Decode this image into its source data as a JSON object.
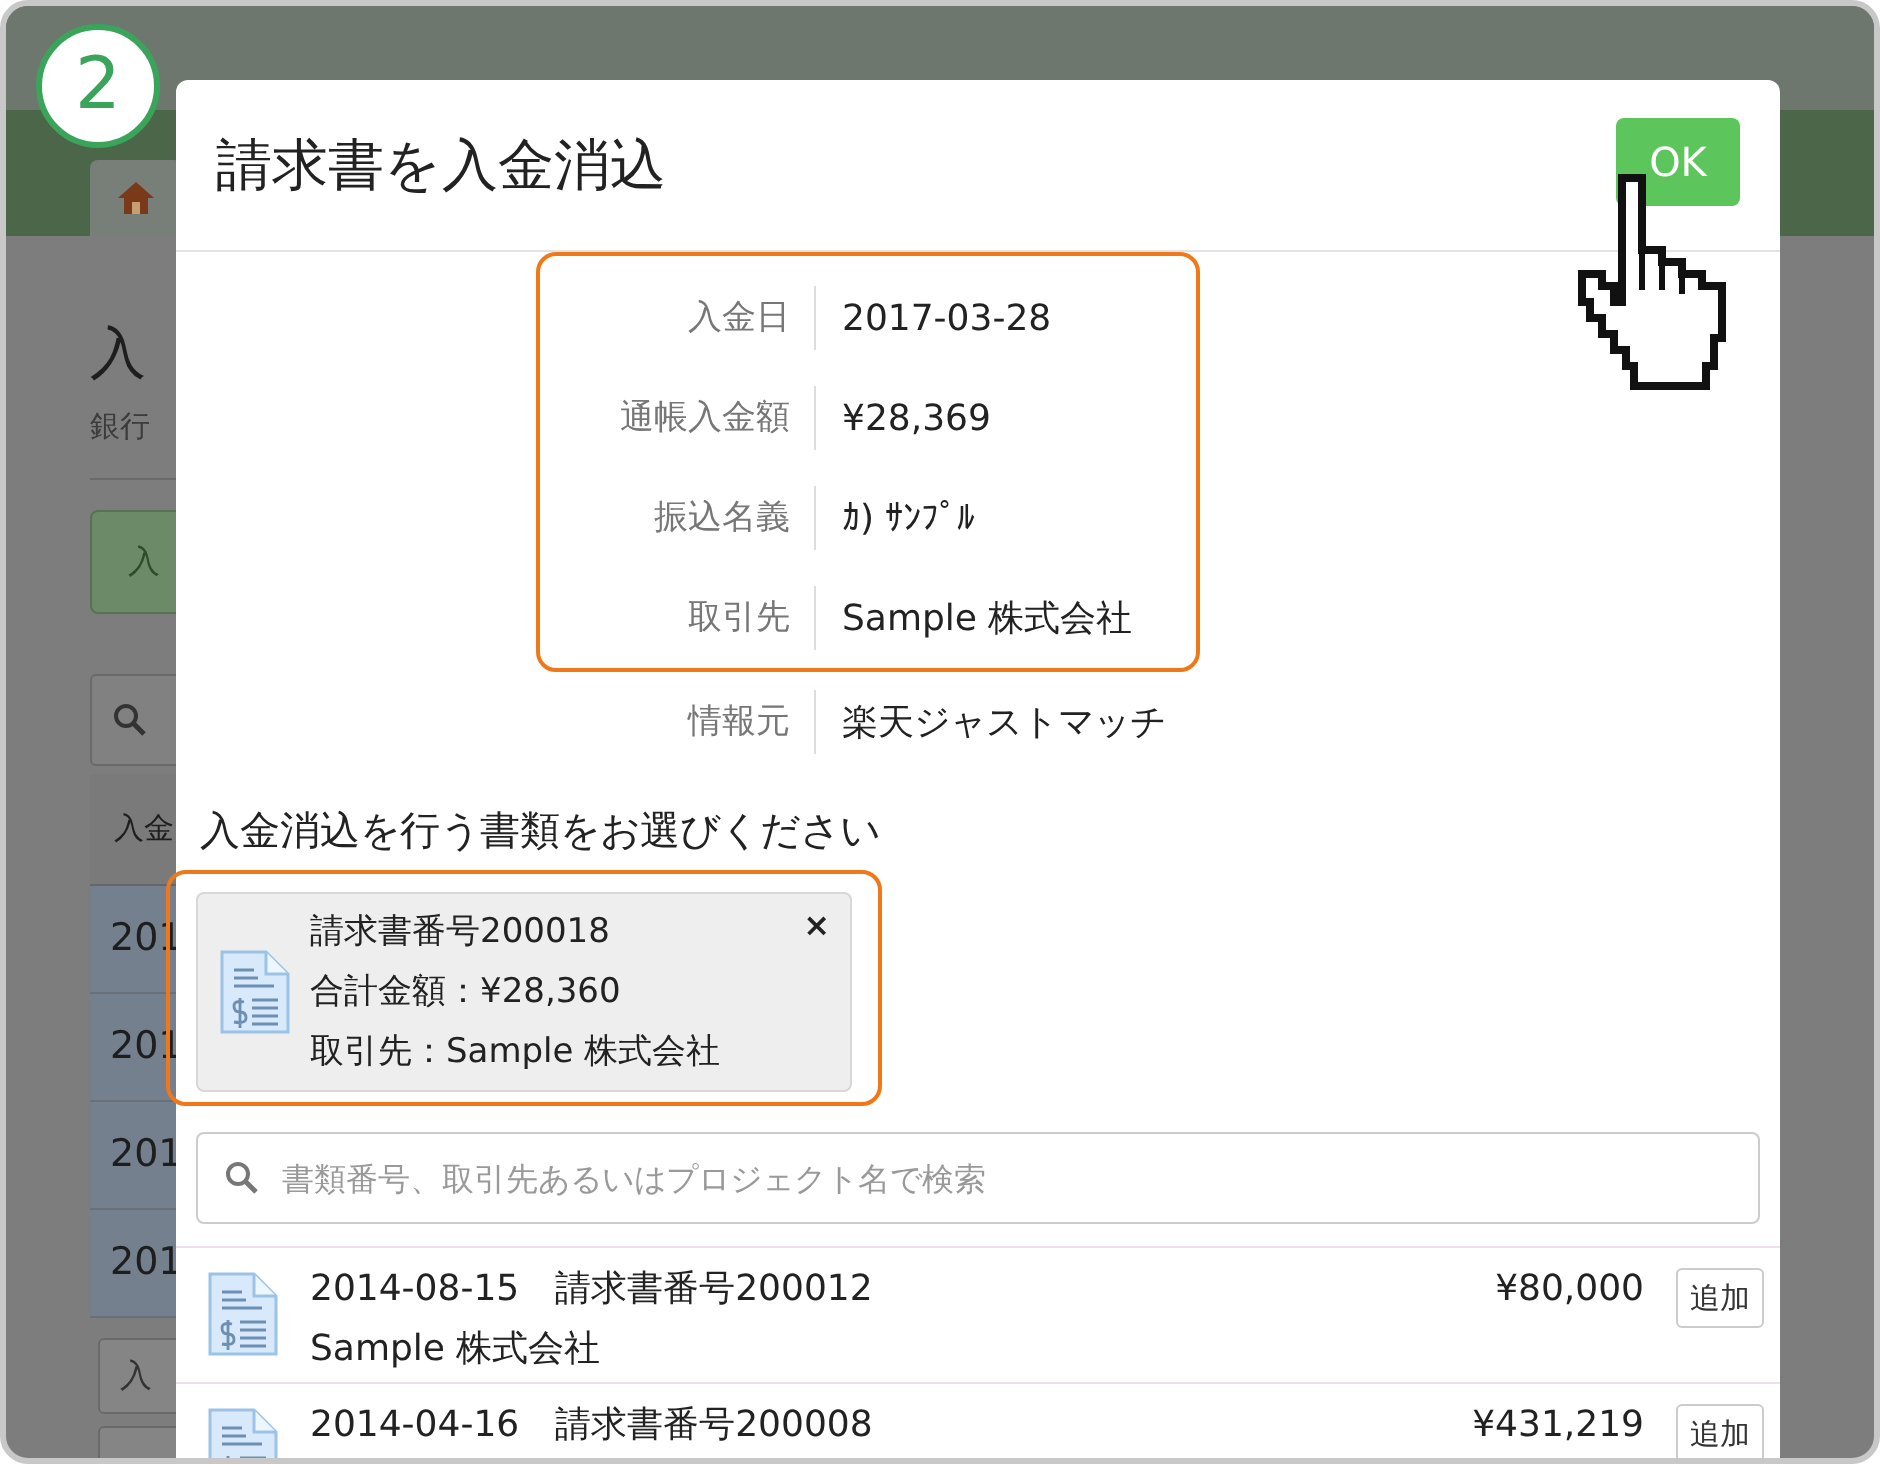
{
  "step_badge": "2",
  "background": {
    "heading": "入",
    "subtitle": "銀行",
    "button": "入",
    "table_header": "入金",
    "rows": [
      "201",
      "201",
      "201",
      "201"
    ],
    "fields": [
      "入"
    ]
  },
  "dialog": {
    "title": "請求書を入金消込",
    "ok_button": "OK",
    "fields": [
      {
        "label": "入金日",
        "value": "2017-03-28",
        "highlighted": true
      },
      {
        "label": "通帳入金額",
        "value": "¥28,369",
        "highlighted": true
      },
      {
        "label": "振込名義",
        "value": "ｶ) ｻﾝﾌﾟﾙ",
        "highlighted": true
      },
      {
        "label": "取引先",
        "value": "Sample 株式会社",
        "highlighted": true
      },
      {
        "label": "情報元",
        "value": "楽天ジャストマッチ",
        "highlighted": false
      }
    ],
    "section_title": "入金消込を行う書類をお選びください",
    "selected_documents": [
      {
        "number": "請求書番号200018",
        "total": "合計金額：¥28,360",
        "client": "取引先：Sample 株式会社",
        "remove": "×"
      }
    ],
    "search": {
      "placeholder": "書類番号、取引先あるいはプロジェクト名で検索"
    },
    "documents": [
      {
        "date": "2014-08-15",
        "number": "請求書番号200012",
        "client": "Sample 株式会社",
        "amount": "¥80,000",
        "add_button": "追加"
      },
      {
        "date": "2014-04-16",
        "number": "請求書番号200008",
        "amount": "¥431,219",
        "add_button": "追加"
      }
    ]
  }
}
